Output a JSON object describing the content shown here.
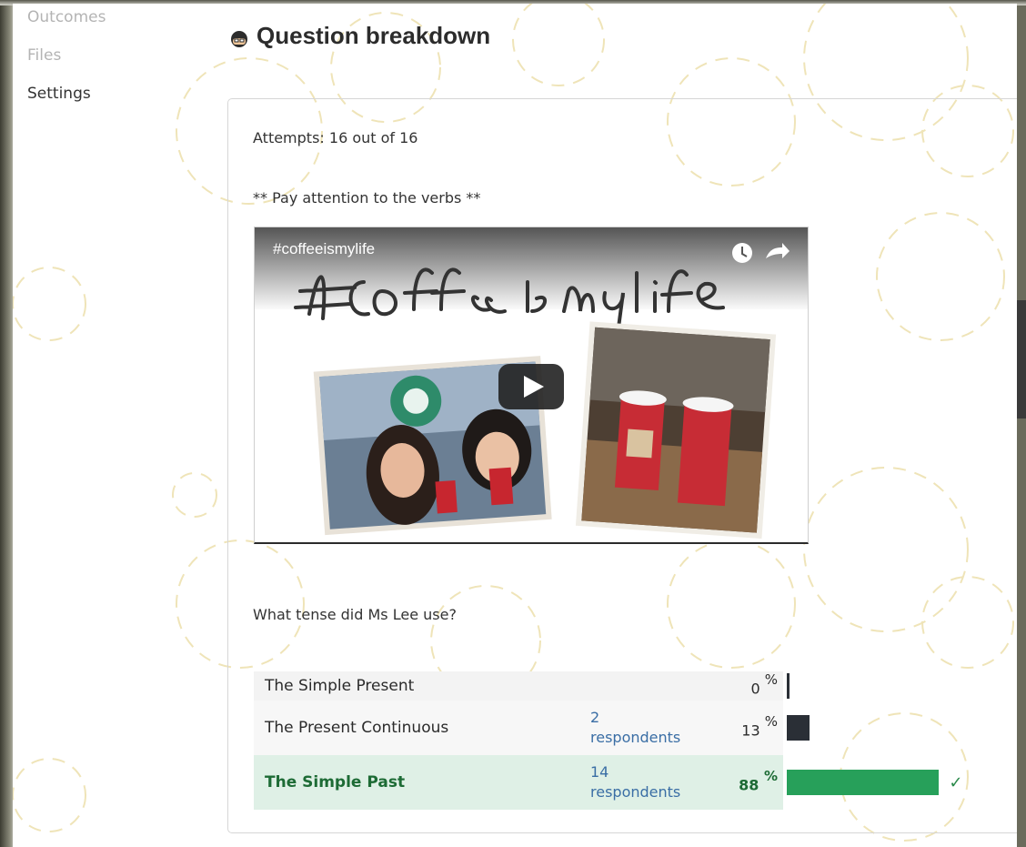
{
  "sidebar": {
    "items": [
      {
        "label": "Outcomes"
      },
      {
        "label": "Files"
      },
      {
        "label": "Settings"
      }
    ]
  },
  "main": {
    "title": "Question breakdown",
    "title_icon": "quiz-face-icon",
    "attempts": "Attempts: 16 out of 16",
    "hint": "** Pay attention to the verbs **",
    "video": {
      "title": "#coffeeismylife",
      "handwriting": "#coffee is my life",
      "icons": [
        "clock-icon",
        "share-icon",
        "play-icon"
      ]
    },
    "question": "What tense did Ms Lee use?",
    "answers": [
      {
        "label": "The Simple Present",
        "respondents_count": "",
        "respondents_label": "",
        "percent": "0",
        "fraction": 0.0,
        "correct": false
      },
      {
        "label": "The Present Continuous",
        "respondents_count": "2",
        "respondents_label": "respondents",
        "percent": "13",
        "fraction": 0.13,
        "correct": false
      },
      {
        "label": "The Simple Past",
        "respondents_count": "14",
        "respondents_label": "respondents",
        "percent": "88",
        "fraction": 0.88,
        "correct": true
      }
    ],
    "percent_sign": "%",
    "correct_mark": "✓"
  },
  "colors": {
    "bar_incorrect": "#2a2f36",
    "bar_correct": "#27a05a",
    "correct_row": "#dff0e6",
    "correct_text": "#1d6b35",
    "link": "#3a6ea5"
  }
}
